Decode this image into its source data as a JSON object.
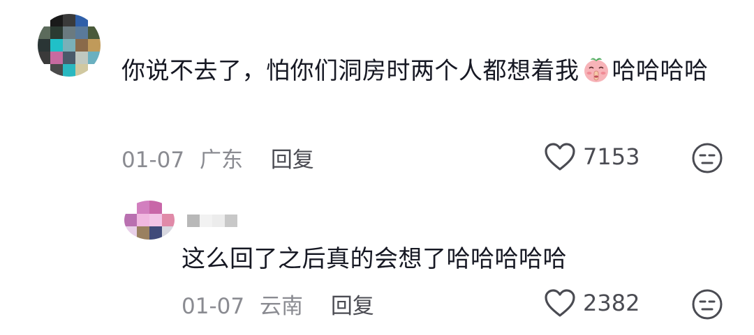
{
  "comment": {
    "text_part1": "你说不去了，怕你们洞房时两个人都想着我",
    "emoji": "shushing-peach-emoji",
    "text_part2": "哈哈哈哈",
    "date": "01-07",
    "location": "广东",
    "reply_label": "回复",
    "like_count": "7153"
  },
  "reply": {
    "text": "这么回了之后真的会想了哈哈哈哈哈",
    "date": "01-07",
    "location": "云南",
    "reply_label": "回复",
    "like_count": "2382"
  },
  "colors": {
    "text": "#161823",
    "meta": "#8a8b91",
    "action": "#4a4b52"
  }
}
